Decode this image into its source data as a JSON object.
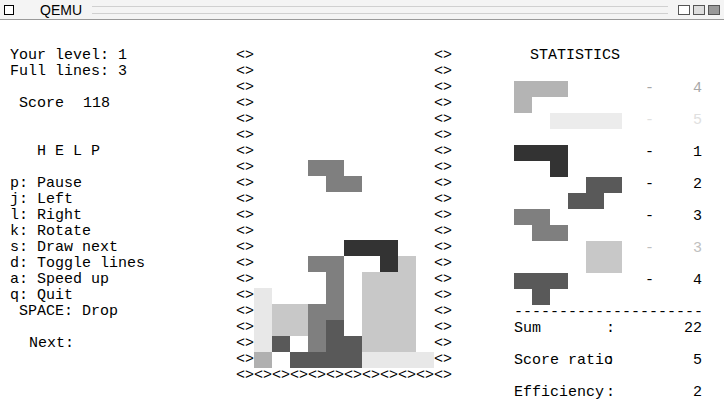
{
  "window": {
    "title": "QEMU"
  },
  "left": {
    "level": "Your level: 1",
    "full_lines": "Full lines: 3",
    "score_label": "Score",
    "score": "118",
    "help_title": "H E L P",
    "help": [
      "p: Pause",
      "j: Left",
      "l: Right",
      "k: Rotate",
      "s: Draw next",
      "d: Toggle lines",
      "a: Speed up",
      "q: Quit"
    ],
    "space_help": "SPACE: Drop",
    "next_label": "Next:"
  },
  "board": {
    "wall": "<>",
    "floor": "<><><><><><><><><><><><>",
    "rows": [
      [
        "",
        "",
        "",
        "",
        "",
        "",
        "",
        "",
        "",
        ""
      ],
      [
        "",
        "",
        "",
        "",
        "",
        "",
        "",
        "",
        "",
        ""
      ],
      [
        "",
        "",
        "",
        "",
        "",
        "",
        "",
        "",
        "",
        ""
      ],
      [
        "",
        "",
        "",
        "",
        "",
        "",
        "",
        "",
        "",
        ""
      ],
      [
        "",
        "",
        "",
        "",
        "",
        "",
        "",
        "",
        "",
        ""
      ],
      [
        "",
        "",
        "",
        "",
        "",
        "",
        "",
        "",
        "",
        ""
      ],
      [
        "",
        "",
        "",
        "",
        "",
        "",
        "",
        "",
        "",
        ""
      ],
      [
        "",
        "",
        "",
        "#7f7f7f",
        "#7f7f7f",
        "",
        "",
        "",
        "",
        ""
      ],
      [
        "",
        "",
        "",
        "",
        "#7f7f7f",
        "#7f7f7f",
        "",
        "",
        "",
        ""
      ],
      [
        "",
        "",
        "",
        "",
        "",
        "",
        "",
        "",
        "",
        ""
      ],
      [
        "",
        "",
        "",
        "",
        "",
        "",
        "",
        "",
        "",
        ""
      ],
      [
        "",
        "",
        "",
        "",
        "",
        "",
        "",
        "",
        "",
        ""
      ],
      [
        "",
        "",
        "",
        "",
        "",
        "#333333",
        "#333333",
        "#333333",
        "",
        ""
      ],
      [
        "",
        "",
        "",
        "#7f7f7f",
        "#7f7f7f",
        "",
        "",
        "#333333",
        "#c8c8c8",
        ""
      ],
      [
        "",
        "",
        "",
        "",
        "#7f7f7f",
        "",
        "#c8c8c8",
        "#c8c8c8",
        "#c8c8c8",
        ""
      ],
      [
        "#e8e8e8",
        "",
        "",
        "",
        "#7f7f7f",
        "",
        "#c8c8c8",
        "#c8c8c8",
        "#c8c8c8",
        ""
      ],
      [
        "#e8e8e8",
        "#c8c8c8",
        "#c8c8c8",
        "#7f7f7f",
        "#7f7f7f",
        "",
        "#c8c8c8",
        "#c8c8c8",
        "#c8c8c8",
        ""
      ],
      [
        "#e8e8e8",
        "#c8c8c8",
        "#c8c8c8",
        "#7f7f7f",
        "#595959",
        "",
        "#c8c8c8",
        "#c8c8c8",
        "#c8c8c8",
        ""
      ],
      [
        "#e8e8e8",
        "#595959",
        "",
        "#7f7f7f",
        "#595959",
        "#595959",
        "#c8c8c8",
        "#c8c8c8",
        "#c8c8c8",
        ""
      ],
      [
        "#b0b0b0",
        "",
        "#595959",
        "#595959",
        "#595959",
        "#595959",
        "#e8e8e8",
        "#e8e8e8",
        "#e8e8e8",
        "#e8e8e8"
      ]
    ]
  },
  "statistics": {
    "title": "STATISTICS",
    "pieces": [
      {
        "cells": [
          "111000",
          "100000"
        ],
        "color": "#b4b4b4",
        "dash": "-",
        "count": "4",
        "text_color": "#a8a8a8"
      },
      {
        "cells": [
          "001111",
          "000000"
        ],
        "color": "#ececec",
        "dash": "-",
        "count": "5",
        "text_color": "#e0e0e0"
      },
      {
        "cells": [
          "111000",
          "001000"
        ],
        "color": "#333333",
        "dash": "-",
        "count": "1",
        "text_color": "#000000"
      },
      {
        "cells": [
          "000011",
          "000110"
        ],
        "color": "#595959",
        "dash": "-",
        "count": "2",
        "text_color": "#000000"
      },
      {
        "cells": [
          "110000",
          "011000"
        ],
        "color": "#7f7f7f",
        "dash": "-",
        "count": "3",
        "text_color": "#000000"
      },
      {
        "cells": [
          "000011",
          "000011"
        ],
        "color": "#c8c8c8",
        "dash": "-",
        "count": "3",
        "text_color": "#c0c0c0"
      },
      {
        "cells": [
          "111000",
          "010000"
        ],
        "color": "#595959",
        "dash": "-",
        "count": "4",
        "text_color": "#000000"
      }
    ],
    "divider": "---------------------",
    "totals": [
      {
        "label": "Sum",
        "sep": ":",
        "value": "22"
      },
      {
        "label": "Score ratio",
        "sep": ":",
        "value": "5"
      },
      {
        "label": "Efficiency",
        "sep": ":",
        "value": "2"
      }
    ]
  }
}
